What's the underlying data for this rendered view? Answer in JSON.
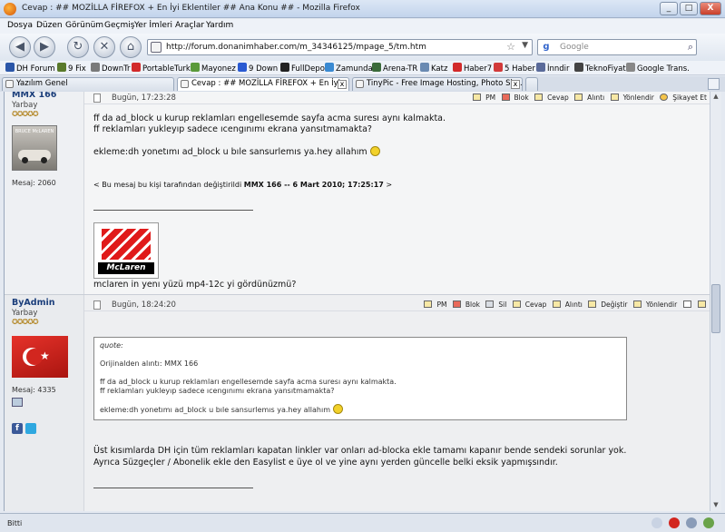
{
  "window": {
    "title": "Cevap : ## MOZİLLA FİREFOX + En İyi Eklentiler ## Ana Konu ## - Mozilla Firefox",
    "minimize": "_",
    "maximize": "□",
    "close": "X"
  },
  "menu": [
    "Dosya",
    "Düzen",
    "Görünüm",
    "Geçmiş",
    "Yer İmleri",
    "Araçlar",
    "Yardım"
  ],
  "nav": {
    "url": "http://forum.donanimhaber.com/m_34346125/mpage_5/tm.htm",
    "search_placeholder": "Google",
    "back": "◀",
    "forward": "▶",
    "reload": "↻",
    "stop": "✕",
    "home": "⌂"
  },
  "bookmarks": [
    {
      "label": "DH Forum",
      "color": "#2b56a8"
    },
    {
      "label": "9 Fix",
      "color": "#5a7a2b"
    },
    {
      "label": "DownTr",
      "color": "#7a7a7a"
    },
    {
      "label": "PortableTurk",
      "color": "#d22a2a"
    },
    {
      "label": "Mayonez",
      "color": "#5a9a3a"
    },
    {
      "label": "9 Down",
      "color": "#2a5ad2"
    },
    {
      "label": "FullDepo",
      "color": "#222222"
    },
    {
      "label": "Zamunda",
      "color": "#3a8ad2"
    },
    {
      "label": "Arena-TR",
      "color": "#3a6a3a"
    },
    {
      "label": "Katz",
      "color": "#6a8ab2"
    },
    {
      "label": "Haber7",
      "color": "#d22a2a"
    },
    {
      "label": "5 Haber",
      "color": "#d23a3a"
    },
    {
      "label": "İnndir",
      "color": "#5a6a9a"
    },
    {
      "label": "TeknoFiyat",
      "color": "#444444"
    },
    {
      "label": "Google Trans.",
      "color": "#888888"
    }
  ],
  "tabs": [
    {
      "label": "Yazılım Genel"
    },
    {
      "label": "Cevap : ## MOZİLLA FİREFOX + En İyi ..."
    },
    {
      "label": "TinyPic - Free Image Hosting, Photo Sha..."
    }
  ],
  "post1": {
    "username": "MMX 166",
    "rank": "Yarbay",
    "stars": "✪✪✪✪✪",
    "avatar_text": "BRUCE McLAREN",
    "msgcount": "Mesaj: 2060",
    "date": "Bugün, 17:23:28",
    "actions": [
      "PM",
      "Blok",
      "Cevap",
      "Alıntı",
      "Yönlendir",
      "Şikayet Et"
    ],
    "line1": "ff da ad_block u kurup reklamları engellesemde sayfa acma suresı aynı kalmakta.",
    "line2": "ff reklamları yukleyıp sadece ıcengınımı ekrana yansıtmamakta?",
    "line3": "ekleme:dh yonetımı ad_block u bıle sansurlemıs ya.hey allahım",
    "edit_prefix": "< Bu mesaj bu kişi tarafından değiştirildi",
    "edit_user": "MMX 166 -- 6 Mart 2010; 17:25:17",
    "edit_suffix": ">",
    "logo_text": "McLaren",
    "line4": "mclaren in yenı yüzü mp4-12c yi gördünüzmü?"
  },
  "post2": {
    "username": "ByAdmin",
    "rank": "Yarbay",
    "stars": "✪✪✪✪✪",
    "msgcount": "Mesaj: 4335",
    "date": "Bugün, 18:24:20",
    "actions": [
      "PM",
      "Blok",
      "Sil",
      "Cevap",
      "Alıntı",
      "Değiştir",
      "Yönlendir"
    ],
    "quote_label": "quote:",
    "quote_origin": "Orijinalden alıntı: MMX 166",
    "quote_l1": "ff da ad_block u kurup reklamları engellesemde sayfa acma suresı aynı kalmakta.",
    "quote_l2": "ff reklamları yukleyıp sadece ıcengınımı ekrana yansıtmamakta?",
    "quote_l3": "ekleme:dh yonetımı ad_block u bıle sansurlemıs ya.hey allahım",
    "reply_l1": "Üst kısımlarda DH için tüm reklamları kapatan linkler var onları ad-blocka ekle tamamı kapanır bende sendeki sorunlar yok.",
    "reply_l2": "Ayrıca Süzgeçler / Abonelik ekle den Easylist e üye ol ve yine aynı yerden güncelle belki eksik yapmışsındır."
  },
  "status": {
    "text": "Bitti"
  }
}
